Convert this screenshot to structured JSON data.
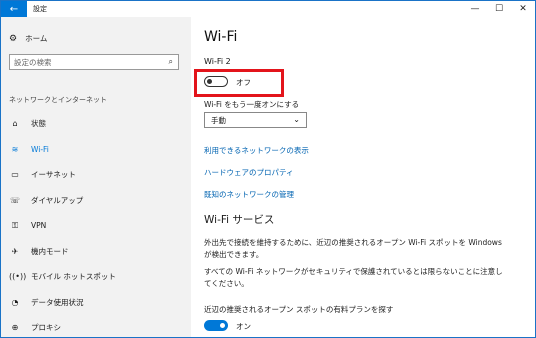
{
  "window": {
    "title": "設定",
    "back_icon": "←",
    "min": "—",
    "max": "☐",
    "close": "✕"
  },
  "sidebar": {
    "home": "ホーム",
    "search_placeholder": "設定の検索",
    "section": "ネットワークとインターネット",
    "items": [
      {
        "label": "状態",
        "icon": "⌂"
      },
      {
        "label": "Wi-Fi",
        "icon": "≋"
      },
      {
        "label": "イーサネット",
        "icon": "▭"
      },
      {
        "label": "ダイヤルアップ",
        "icon": "☏"
      },
      {
        "label": "VPN",
        "icon": "⚿"
      },
      {
        "label": "機内モード",
        "icon": "✈"
      },
      {
        "label": "モバイル ホットスポット",
        "icon": "((•))"
      },
      {
        "label": "データ使用状況",
        "icon": "◔"
      },
      {
        "label": "プロキシ",
        "icon": "⊕"
      }
    ],
    "active_index": 1
  },
  "main": {
    "title": "Wi-Fi",
    "wifi_sub": "Wi-Fi 2",
    "toggle1_label": "オフ",
    "toggle1_state": "off",
    "reenable_label": "Wi-Fi をもう一度オンにする",
    "dropdown_value": "手動",
    "links": [
      "利用できるネットワークの表示",
      "ハードウェアのプロパティ",
      "既知のネットワークの管理"
    ],
    "services_title": "Wi-Fi サービス",
    "para1": "外出先で接続を維持するために、近辺の推奨されるオープン Wi-Fi スポットを Windows が検出できます。",
    "para2": "すべての Wi-Fi ネットワークがセキュリティで保護されているとは限らないことに注意してください。",
    "paid_label": "近辺の推奨されるオープン スポットの有料プランを探す",
    "toggle2_label": "オン",
    "toggle2_state": "on",
    "highlight_color": "#e3141b",
    "accent": "#0078d7"
  }
}
